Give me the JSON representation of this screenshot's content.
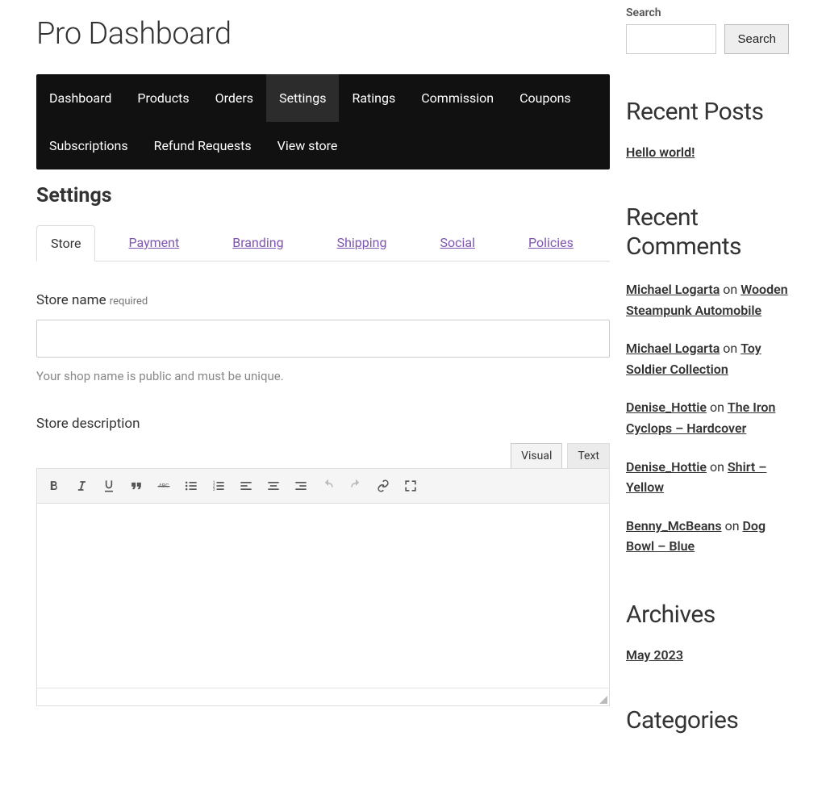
{
  "page_title": "Pro Dashboard",
  "nav": {
    "items": [
      {
        "label": "Dashboard",
        "active": false
      },
      {
        "label": "Products",
        "active": false
      },
      {
        "label": "Orders",
        "active": false
      },
      {
        "label": "Settings",
        "active": true
      },
      {
        "label": "Ratings",
        "active": false
      },
      {
        "label": "Commission",
        "active": false
      },
      {
        "label": "Coupons",
        "active": false
      },
      {
        "label": "Subscriptions",
        "active": false
      },
      {
        "label": "Refund Requests",
        "active": false
      },
      {
        "label": "View store",
        "active": false
      }
    ]
  },
  "main": {
    "heading": "Settings",
    "tabs": [
      {
        "label": "Store",
        "active": true
      },
      {
        "label": "Payment",
        "active": false
      },
      {
        "label": "Branding",
        "active": false
      },
      {
        "label": "Shipping",
        "active": false
      },
      {
        "label": "Social",
        "active": false
      },
      {
        "label": "Policies",
        "active": false
      }
    ],
    "store_name": {
      "label": "Store name",
      "required_text": "required",
      "value": "",
      "help": "Your shop name is public and must be unique."
    },
    "store_description": {
      "label": "Store description",
      "editor_tabs": {
        "visual": "Visual",
        "text": "Text"
      }
    }
  },
  "sidebar": {
    "search": {
      "label": "Search",
      "button": "Search"
    },
    "recent_posts": {
      "title": "Recent Posts",
      "items": [
        "Hello world!"
      ]
    },
    "recent_comments": {
      "title": "Recent Comments",
      "on_text": "on",
      "items": [
        {
          "author": "Michael Logarta",
          "post": "Wooden Steampunk Automobile"
        },
        {
          "author": "Michael Logarta",
          "post": "Toy Soldier Collection"
        },
        {
          "author": "Denise_Hottie",
          "post": "The Iron Cyclops – Hardcover"
        },
        {
          "author": "Denise_Hottie",
          "post": "Shirt – Yellow"
        },
        {
          "author": "Benny_McBeans",
          "post": "Dog Bowl – Blue"
        }
      ]
    },
    "archives": {
      "title": "Archives",
      "items": [
        "May 2023"
      ]
    },
    "categories": {
      "title": "Categories"
    }
  }
}
